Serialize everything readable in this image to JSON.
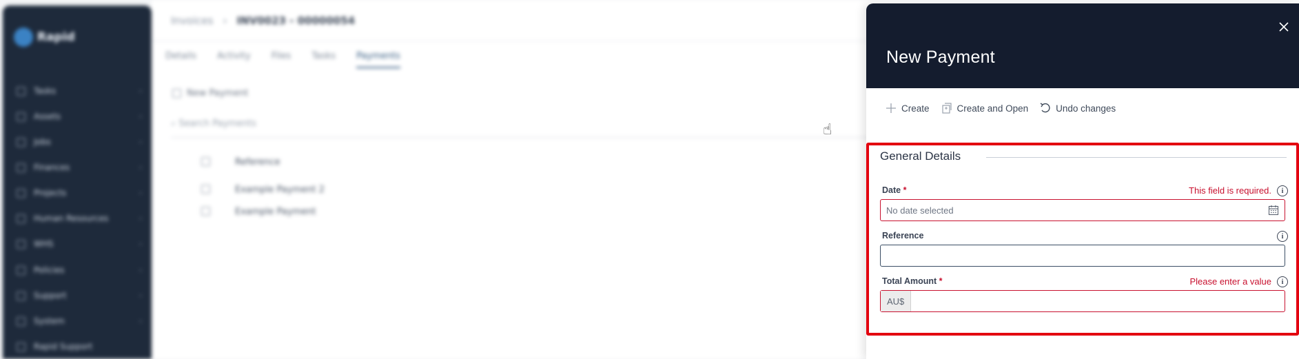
{
  "background": {
    "logo_text": "Rapid",
    "nav_items": [
      {
        "label": "Tasks"
      },
      {
        "label": "Assets"
      },
      {
        "label": "Jobs"
      },
      {
        "label": "Finances"
      },
      {
        "label": "Projects"
      },
      {
        "label": "Human Resources"
      },
      {
        "label": "WHS"
      },
      {
        "label": "Policies"
      },
      {
        "label": "Support"
      },
      {
        "label": "System"
      },
      {
        "label": "Rapid Support"
      }
    ],
    "breadcrumb": [
      "Invoices",
      "INV0023 - 00000054"
    ],
    "tabs": [
      "Details",
      "Activity",
      "Files",
      "Tasks",
      "Payments"
    ],
    "active_tab": "Payments",
    "toolbar_button": "New Payment",
    "search_placeholder": "Search Payments",
    "grid_header": "Reference",
    "grid_rows": [
      "Example Payment 2",
      "Example Payment"
    ]
  },
  "panel": {
    "title": "New Payment",
    "actions": {
      "create": "Create",
      "create_and_open": "Create and Open",
      "undo": "Undo changes"
    },
    "section_title": "General Details",
    "fields": {
      "date": {
        "label": "Date",
        "required_mark": "*",
        "error": "This field is required.",
        "placeholder": "No date selected"
      },
      "reference": {
        "label": "Reference",
        "value": ""
      },
      "total_amount": {
        "label": "Total Amount",
        "required_mark": "*",
        "error": "Please enter a value",
        "prefix": "AU$",
        "value": ""
      }
    }
  },
  "colors": {
    "panel_header": "#141c2e",
    "error": "#c8102e",
    "highlight_border": "#e3000f",
    "sidebar": "#1e2a3b"
  }
}
